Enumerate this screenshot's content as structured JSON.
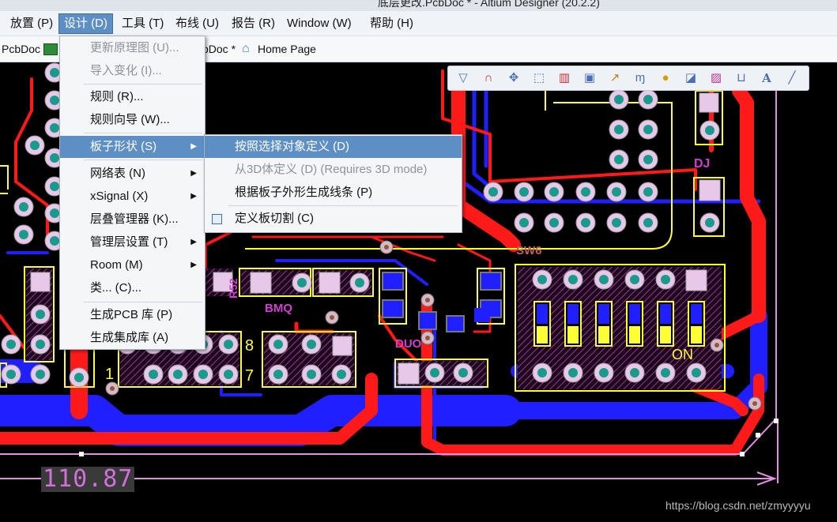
{
  "window": {
    "title": "底层更改.PcbDoc * - Altium Designer (20.2.2)"
  },
  "menubar": [
    {
      "label": "放置 (P)"
    },
    {
      "label": "设计 (D)"
    },
    {
      "label": "工具 (T)"
    },
    {
      "label": "布线 (U)"
    },
    {
      "label": "报告 (R)"
    },
    {
      "label": "Window (W)"
    },
    {
      "label": "帮助 (H)"
    }
  ],
  "tabs": [
    {
      "label": "PcbDoc"
    },
    {
      "label": "bDoc *"
    },
    {
      "label": "Home Page"
    }
  ],
  "design_menu": [
    {
      "label": "更新原理图 (U)..."
    },
    {
      "label": "导入变化 (I)..."
    },
    {
      "label": "规则 (R)..."
    },
    {
      "label": "规则向导 (W)..."
    },
    {
      "label": "板子形状 (S)"
    },
    {
      "label": "网络表 (N)"
    },
    {
      "label": "xSignal (X)"
    },
    {
      "label": "层叠管理器 (K)..."
    },
    {
      "label": "管理层设置 (T)"
    },
    {
      "label": "Room (M)"
    },
    {
      "label": "类... (C)..."
    },
    {
      "label": "生成PCB 库 (P)"
    },
    {
      "label": "生成集成库 (A)"
    }
  ],
  "board_shape_submenu": [
    {
      "label": "按照选择对象定义 (D)"
    },
    {
      "label": "从3D体定义 (D) (Requires 3D mode)"
    },
    {
      "label": "根据板子外形生成线条 (P)"
    },
    {
      "label": "定义板切割 (C)"
    }
  ],
  "pcb_labels": {
    "dj": "DJ",
    "sw6": "SW6",
    "bmq": "BMQ",
    "duo": "DUO",
    "r52": "R52",
    "num8": "8",
    "num7": "7",
    "num1": "1",
    "on": "ON"
  },
  "dimension": {
    "value": "110.87"
  },
  "watermark": "https://blog.csdn.net/zmyyyyu",
  "colors": {
    "top_copper": "#ff1a1a",
    "bottom_copper": "#1a1aff",
    "silkscreen": "#ffff33",
    "outline": "#e090e0",
    "highlight": "#5e8fc4"
  }
}
